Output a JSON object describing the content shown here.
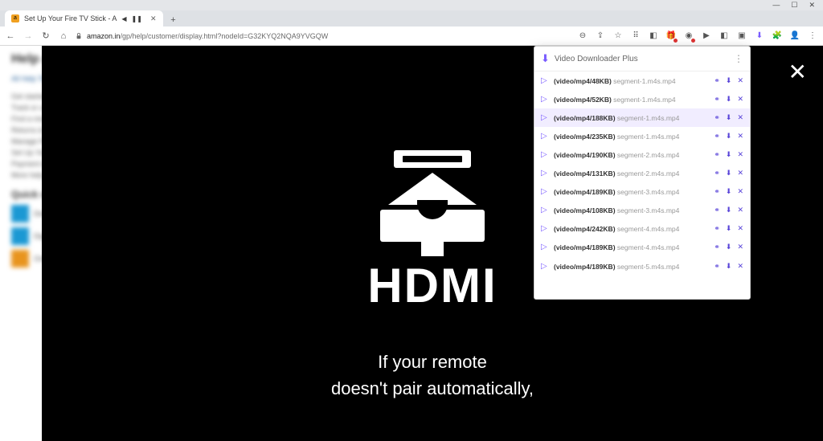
{
  "window": {
    "minimize": "—",
    "maximize": "☐",
    "close": "✕"
  },
  "tab": {
    "title": "Set Up Your Fire TV Stick - A",
    "favicon_letter": "a",
    "audio_glyph": "◀",
    "pause_glyph": "❚❚",
    "close_glyph": "✕"
  },
  "newtab_glyph": "+",
  "nav": {
    "back": "←",
    "forward": "→",
    "reload": "↻",
    "home": "⌂"
  },
  "url": {
    "domain": "amazon.in",
    "path": "/gp/help/customer/display.html?nodeId=G32KYQ2NQA9YVGQW"
  },
  "toolbar_icons": {
    "zoom": "⊖",
    "share": "⇪",
    "star": "☆",
    "puzzle": "⠿",
    "i1": "◧",
    "i2": "🎁",
    "i3": "◉",
    "i4": "▶",
    "i5": "◧",
    "i6": "▣",
    "i7": "⬇",
    "i8": "🧩",
    "i9": "👤",
    "i10": "⋮"
  },
  "blurred": {
    "h1": "Help and Customer Service",
    "allhelp": "All Help Topics",
    "section": "Quick solutions",
    "lines": [
      "Get started with your Amazon account",
      "Track or cancel orders",
      "Find a missing package",
      "Returns & refunds",
      "Manage Prime",
      "Set Up Your Fire TV Stick",
      "Payment & pricing",
      "More help"
    ],
    "items": [
      "Devices",
      "Digital services",
      "Orders"
    ]
  },
  "video": {
    "hdmi_label": "HDMI",
    "caption_l1": "If your remote",
    "caption_l2": "doesn't pair automatically,",
    "close_glyph": "✕"
  },
  "ext": {
    "title": "Video Downloader Plus",
    "logo_glyph": "⬇",
    "menu_glyph": "⋮",
    "link_glyph": "⚭",
    "download_glyph": "⬇",
    "close_glyph": "✕",
    "play_glyph": "▷",
    "items": [
      {
        "meta": "(video/mp4/48KB)",
        "name": "segment-1.m4s.mp4",
        "highlight": false
      },
      {
        "meta": "(video/mp4/52KB)",
        "name": "segment-1.m4s.mp4",
        "highlight": false
      },
      {
        "meta": "(video/mp4/188KB)",
        "name": "segment-1.m4s.mp4",
        "highlight": true
      },
      {
        "meta": "(video/mp4/235KB)",
        "name": "segment-1.m4s.mp4",
        "highlight": false
      },
      {
        "meta": "(video/mp4/190KB)",
        "name": "segment-2.m4s.mp4",
        "highlight": false
      },
      {
        "meta": "(video/mp4/131KB)",
        "name": "segment-2.m4s.mp4",
        "highlight": false
      },
      {
        "meta": "(video/mp4/189KB)",
        "name": "segment-3.m4s.mp4",
        "highlight": false
      },
      {
        "meta": "(video/mp4/108KB)",
        "name": "segment-3.m4s.mp4",
        "highlight": false
      },
      {
        "meta": "(video/mp4/242KB)",
        "name": "segment-4.m4s.mp4",
        "highlight": false
      },
      {
        "meta": "(video/mp4/189KB)",
        "name": "segment-4.m4s.mp4",
        "highlight": false
      },
      {
        "meta": "(video/mp4/189KB)",
        "name": "segment-5.m4s.mp4",
        "highlight": false
      }
    ]
  }
}
